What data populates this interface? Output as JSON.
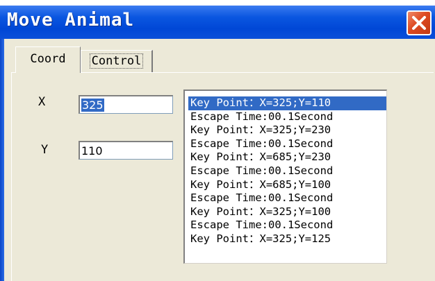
{
  "window": {
    "title": "Move Animal",
    "close_icon": "close-icon",
    "accent_color": "#0a56e0",
    "close_color": "#dd4a22"
  },
  "tabs": [
    {
      "label": "Coord",
      "active": true
    },
    {
      "label": "Control",
      "active": false
    }
  ],
  "coord": {
    "x_label": "X",
    "x_value": "325",
    "y_label": "Y",
    "y_value": "110"
  },
  "key_points": {
    "selected_index": 0,
    "items": [
      "Key Point：X=325;Y=110",
      "Escape Time:00.1Second",
      "Key Point：X=325;Y=230",
      "Escape Time:00.1Second",
      "Key Point：X=685;Y=230",
      "Escape Time:00.1Second",
      "Key Point：X=685;Y=100",
      "Escape Time:00.1Second",
      "Key Point：X=325;Y=100",
      "Escape Time:00.1Second",
      "Key Point：X=325;Y=125"
    ]
  }
}
